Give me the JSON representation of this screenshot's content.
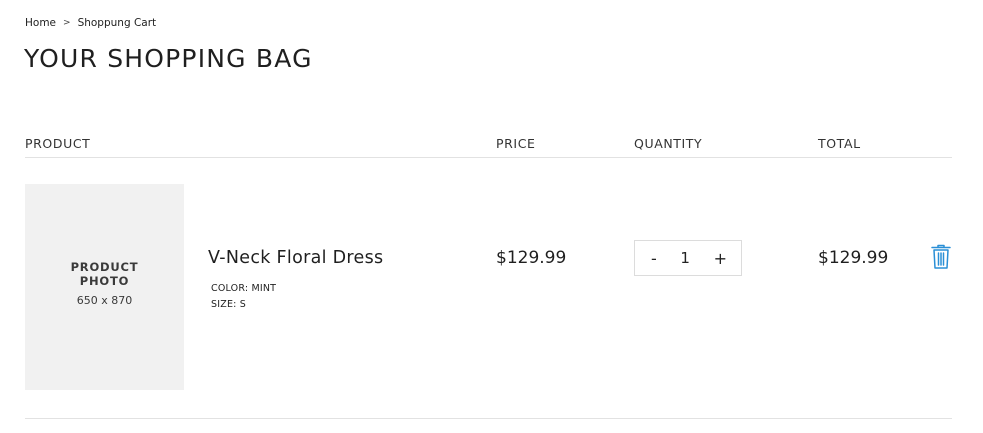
{
  "breadcrumb": {
    "home": "Home",
    "separator": ">",
    "current": "Shoppung Cart"
  },
  "page": {
    "title": "YOUR SHOPPING BAG"
  },
  "table": {
    "headers": {
      "product": "PRODUCT",
      "price": "PRICE",
      "quantity": "QUANTITY",
      "total": "TOTAL"
    },
    "items": [
      {
        "photo_label": "PRODUCT PHOTO",
        "photo_dims": "650 x 870",
        "name": "V-Neck Floral Dress",
        "color": "COLOR: MINT",
        "size": "SIZE: S",
        "price": "$129.99",
        "quantity": "1",
        "decrement": "-",
        "increment": "+",
        "total": "$129.99",
        "delete_icon": "trash-icon"
      }
    ]
  },
  "colors": {
    "accent": "#2a8fd6",
    "text": "#222222",
    "placeholder_bg": "#f1f1f1",
    "divider": "#e2e2e2"
  }
}
